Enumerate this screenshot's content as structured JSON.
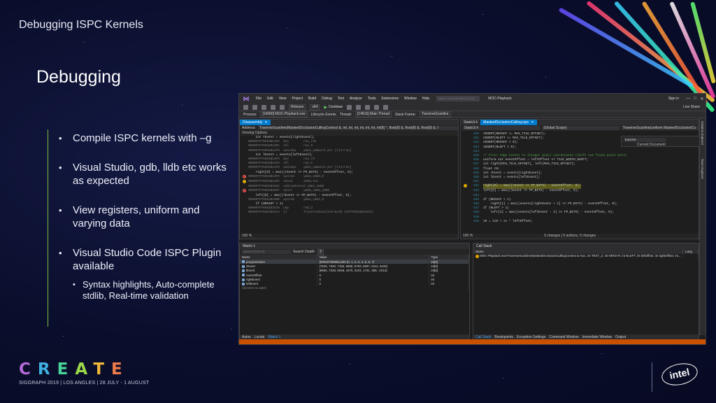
{
  "slide": {
    "deck_title": "Debugging ISPC Kernels",
    "title": "Debugging",
    "bullets": [
      "Compile ISPC kernels with –g",
      "Visual Studio, gdb,  lldb etc works as  expected",
      "View registers,  uniform and varying data",
      "Visual Studio Code ISPC Plugin available"
    ],
    "sub_bullets": [
      "Syntax highlights, Auto-complete stdlib, Real-time validation"
    ]
  },
  "footer": {
    "create_letters": [
      "C",
      "R",
      "E",
      "A",
      "T",
      "E"
    ],
    "siggraph": "SIGGRAPH 2019 | LOS ANGLES | 28 JULY - 1 AUGUST",
    "intel": "intel"
  },
  "colors": {
    "accent_green": "#7fbf3f",
    "vs_blue": "#007acc",
    "vs_status": "#ca5100"
  },
  "icons": {
    "vs_logo": "visual-studio-icon",
    "play": "play-icon",
    "breakpoint": "breakpoint-icon",
    "current_line": "instruction-pointer-icon"
  },
  "vs": {
    "logo": "⋈",
    "menu": [
      "File",
      "Edit",
      "View",
      "Project",
      "Build",
      "Debug",
      "Test",
      "Analyze",
      "Tools",
      "Extensions",
      "Window",
      "Help"
    ],
    "search_placeholder": "Search Visual Studio (Ctrl+Q)",
    "window_title": "MOC-Playback",
    "sign_in": "Sign in",
    "win_controls": [
      "—",
      "□",
      "✕"
    ],
    "toolbar": {
      "continue": "Continue",
      "live_share": "Live Share",
      "release": "Release",
      "platform": "x64"
    },
    "process_bar": {
      "process_label": "Process:",
      "process": "[16680] MOC-Playback.exe",
      "lifecycle": "Lifecycle Events",
      "thread_label": "Thread:",
      "thread": "[14816] Main Thread",
      "stack_label": "Stack Frame:",
      "stack": "TraverseScanline"
    },
    "disasm": {
      "tab": "Disassembly",
      "address_label": "Address:",
      "address": "TraverseScanline(MaskedOcclusionCullingContext &, int, int, int, int, int, int, int(8) *, float(8) &, float(8) &, float(8) &, f",
      "viewing_options": "Viewing Options",
      "zoom": "100 %"
    },
    "disasm_lines": [
      {
        "mark": "",
        "text": "    int rEvent = events[rightEvent];",
        "cls": ""
      },
      {
        "mark": "",
        "text": "000007FF6652B14E9  mov        rax,rdx",
        "cls": "addr"
      },
      {
        "mark": "",
        "text": "000007FF6652B14EC  shl        rax,5",
        "cls": "addr"
      },
      {
        "mark": "",
        "text": "000007FF6652B14F0  vmovdqu    ymm3,ymmword ptr [r11+rax]",
        "cls": "addr"
      },
      {
        "mark": "",
        "text": "    int lEvent = events[leftEvent];",
        "cls": ""
      },
      {
        "mark": "",
        "text": "000007FF6652B14F6  mov        rax,r9",
        "cls": "addr"
      },
      {
        "mark": "",
        "text": "000007FF6652B14F9  shl        rax,5",
        "cls": "addr"
      },
      {
        "mark": "",
        "text": "000007FF6652B14FD  vmovdqu    ymm2,ymmword ptr [r11+rax]",
        "cls": "addr"
      },
      {
        "mark": "",
        "text": "",
        "cls": ""
      },
      {
        "mark": "",
        "text": "    right[0] = max((rEvent >> FP_BITS) - eventOffset, 0);",
        "cls": ""
      },
      {
        "mark": "bp",
        "text": "000007FF6652B14F9  vpsrad     ymm2,ymm0,0",
        "cls": "addr"
      },
      {
        "mark": "cur",
        "text": "000007FF6652B14FE  vmovd      xmm0,esi",
        "cls": "addr"
      },
      {
        "mark": "",
        "text": "000007FF6652B1502  vpbroadcastd ymm4,xmm0",
        "cls": "addr"
      },
      {
        "mark": "bp",
        "text": "000007FF6652B1507  vpxor      ymm0,ymm0,ymm0",
        "cls": "addr"
      },
      {
        "mark": "",
        "text": "    left[0] = max((lEvent >> FP_BITS) - eventOffset, 0);",
        "cls": ""
      },
      {
        "mark": "",
        "text": "000007FF6652B150B  vpsrad     ymm1,ymm3,0",
        "cls": "addr"
      },
      {
        "mark": "",
        "text": "",
        "cls": ""
      },
      {
        "mark": "",
        "text": "    if (NRIGHT > 1)",
        "cls": ""
      },
      {
        "mark": "",
        "text": "000007FF6652B1510  cmp        r8d,2",
        "cls": "addr"
      },
      {
        "mark": "",
        "text": "000007FF6652B1514  jl         TraverseScanline+0x4b (07FF6652B1534h)",
        "cls": "addr"
      }
    ],
    "source": {
      "tabs": [
        {
          "label": "StatsUi.h",
          "active": false
        },
        {
          "label": "MaskedOcclusionCulling.ispc",
          "active": true
        }
      ],
      "file": "StatsUi.h",
      "scope": "(Global Scope)",
      "member": "TraverseScanline(uniform MaskedOcclusionCu",
      "zoom": "100 %",
      "changes": "0 changes | 0 authors, 0 changes"
    },
    "source_lines": [
      {
        "n": "620",
        "text": "ASSERT(NRIGHT <= MAX_TILE_OFFSET);",
        "hl": false,
        "cur": false
      },
      {
        "n": "621",
        "text": "ASSERT(NLEFT <= MAX_TILE_OFFSET);",
        "hl": false,
        "cur": false
      },
      {
        "n": "622",
        "text": "ASSERT(NRIGHT > 0);",
        "hl": false,
        "cur": false
      },
      {
        "n": "623",
        "text": "ASSERT(NLEFT > 0);",
        "hl": false,
        "cur": false
      },
      {
        "n": "624",
        "text": "",
        "hl": false,
        "cur": false
      },
      {
        "n": "625",
        "text": "// Floor edge events to integer pixel coordinates (shift out fixed point bits)",
        "hl": false,
        "cur": false
      },
      {
        "n": "626",
        "text": "uniform int eventOffset = leftOffset << TILE_WIDTH_SHIFT;",
        "hl": false,
        "cur": false
      },
      {
        "n": "627",
        "text": "int right[MAX_TILE_OFFSET], left[MAX_TILE_OFFSET];",
        "hl": false,
        "cur": false
      },
      {
        "n": "628",
        "text": "float z0;",
        "hl": false,
        "cur": false
      },
      {
        "n": "629",
        "text": "int rEvent = events[rightEvent];",
        "hl": false,
        "cur": false
      },
      {
        "n": "630",
        "text": "int lEvent = events[leftEvent];",
        "hl": false,
        "cur": false
      },
      {
        "n": "631",
        "text": "",
        "hl": false,
        "cur": false
      },
      {
        "n": "632",
        "text": "right[0] = max((rEvent >> FP_BITS) - eventOffset, 0);",
        "hl": true,
        "cur": true
      },
      {
        "n": "633",
        "text": "left[0] = max((lEvent >> FP_BITS) - eventOffset, 0);",
        "hl": false,
        "cur": false
      },
      {
        "n": "634",
        "text": "",
        "hl": false,
        "cur": false
      },
      {
        "n": "635",
        "text": "if (NRIGHT > 1)",
        "hl": false,
        "cur": false
      },
      {
        "n": "636",
        "text": "    right[1] = max((events[rightEvent + 1] >> FP_BITS) - eventOffset, 0);",
        "hl": false,
        "cur": false
      },
      {
        "n": "637",
        "text": "if (NLEFT > 1)",
        "hl": false,
        "cur": false
      },
      {
        "n": "638",
        "text": "    left[1] = max((events[leftEvent - 1] >> FP_BITS) - eventOffset, 0);",
        "hl": false,
        "cur": false
      },
      {
        "n": "639",
        "text": "",
        "hl": false,
        "cur": false
      },
      {
        "n": "640",
        "text": "z0 = iz0 + zx * leftOffset;",
        "hl": false,
        "cur": false
      }
    ],
    "find": {
      "text": "traverse",
      "scope": "Current Document"
    },
    "right_rail": [
      "Solution Explorer",
      "Team Explorer"
    ],
    "watch": {
      "title": "Watch 1",
      "search_placeholder": "Search (Ctrl+E)",
      "depth_label": "Search Depth:",
      "depth": "3",
      "columns": [
        "Name",
        "Value",
        "Type"
      ],
      "rows": [
        {
          "name": "programIndex",
          "value": "{8000079996b13b0 {0, 1, 2, 3, 4, 5, 6, 7}",
          "type": "int[8]"
        },
        {
          "name": "rEvent",
          "value": "{7526, 7340, 7155, 6969, 6783, 6597, 6411, 6225}",
          "type": "int[8]"
        },
        {
          "name": "lEvent",
          "value": "{8592, 7228, 5048, 4470, 3104, 1731, 358, -1013}",
          "type": "int[8]"
        },
        {
          "name": "eventOffset",
          "value": "0",
          "type": "int"
        },
        {
          "name": "rightEvent",
          "value": "0",
          "type": "int"
        },
        {
          "name": "leftEvent",
          "value": "2",
          "type": "int"
        }
      ],
      "add_item": "Add item to watch",
      "tabs": [
        "Autos",
        "Locals",
        "Watch 1"
      ]
    },
    "callstack": {
      "title": "Call Stack",
      "columns": [
        "Name",
        "Lang"
      ],
      "rows": [
        "MOC-Playback.exe!TraverseScanline(MaskedOcclusionCullingContext & moc, int TEST_Z, int NRIGHT, int NLEFT, int leftOffset, int rightOffset, int..."
      ],
      "tabs": [
        "Call Stack",
        "Breakpoints",
        "Exception Settings",
        "Command Window",
        "Immediate Window",
        "Output"
      ]
    }
  }
}
